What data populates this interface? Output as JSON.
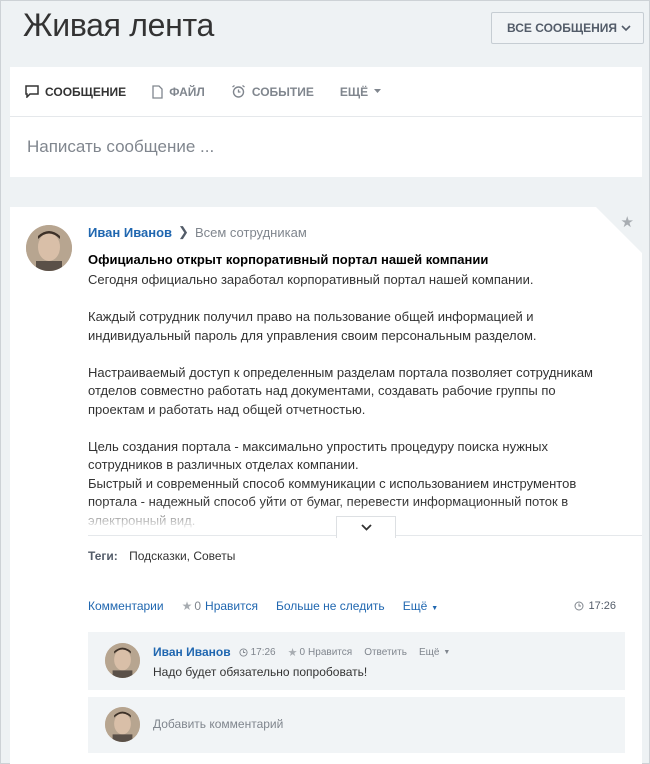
{
  "page": {
    "title": "Живая лента",
    "filter_label": "ВСЕ СООБЩЕНИЯ"
  },
  "composer": {
    "tabs": [
      {
        "label": "СООБЩЕНИЕ",
        "icon": "message-icon",
        "active": true
      },
      {
        "label": "ФАЙЛ",
        "icon": "file-icon",
        "active": false
      },
      {
        "label": "СОБЫТИЕ",
        "icon": "alarm-clock-icon",
        "active": false
      },
      {
        "label": "ЕЩЁ",
        "icon": "caret-down-icon",
        "active": false
      }
    ],
    "placeholder": "Написать сообщение ..."
  },
  "post": {
    "author": "Иван Иванов",
    "destination": "Всем сотрудникам",
    "title": "Официально открыт корпоративный портал нашей компании",
    "paragraphs": [
      "Сегодня официально заработал корпоративный портал нашей компании.",
      "Каждый сотрудник получил право на пользование общей информацией и индивидуальный пароль для управления своим персональным разделом.",
      "Настраиваемый доступ к определенным разделам портала позволяет сотрудникам отделов совместно работать над документами, создавать рабочие группы по проектам и работать над общей отчетностью.",
      "Цель создания портала - максимально упростить процедуру поиска нужных сотрудников в различных отделах компании.",
      "Быстрый и современный способ коммуникации с использованием инструментов портала - надежный способ уйти от бумаг, перевести информационный поток в электронный вид."
    ],
    "tags_label": "Теги:",
    "tags": "Подсказки, Советы",
    "actions": {
      "comments": "Комментарии",
      "likes_count": "0",
      "likes_label": "Нравится",
      "unfollow": "Больше не следить",
      "more": "Ещё"
    },
    "time": "17:26"
  },
  "comment": {
    "author": "Иван Иванов",
    "time": "17:26",
    "likes_count": "0",
    "likes_label": "Нравится",
    "reply": "Ответить",
    "more": "Ещё",
    "text": "Надо будет обязательно попробовать!"
  },
  "add_comment": {
    "placeholder": "Добавить комментарий"
  },
  "colors": {
    "link": "#2067b0",
    "muted": "#80868e",
    "background": "#eef2f4"
  }
}
